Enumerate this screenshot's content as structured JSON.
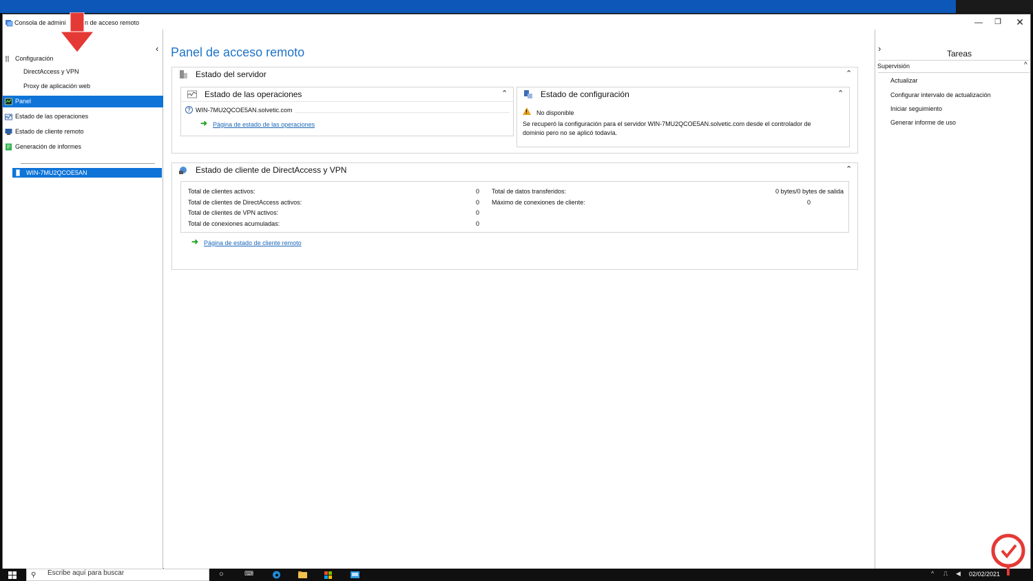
{
  "window": {
    "title": "Consola de administración de acceso remoto",
    "title_visible": "Consola de admini           n de acceso remoto"
  },
  "tree": {
    "items": [
      {
        "label": "Configuración"
      },
      {
        "label": "DirectAccess y VPN"
      },
      {
        "label": "Proxy de aplicación web"
      },
      {
        "label": "Panel"
      },
      {
        "label": "Estado de las operaciones"
      },
      {
        "label": "Estado de cliente remoto"
      },
      {
        "label": "Generación de informes"
      }
    ],
    "server": "WIN-7MU2QCOE5AN"
  },
  "main": {
    "title": "Panel de acceso remoto",
    "server_status": {
      "title": "Estado del servidor",
      "operations": {
        "title": "Estado de las operaciones",
        "server": "WIN-7MU2QCOE5AN.solvetic.com",
        "link": "Página de estado de las operaciones"
      },
      "config": {
        "title": "Estado de configuración",
        "status": "No disponible",
        "message_line1": "Se recuperó la configuración para el servidor WIN-7MU2QCOE5AN.solvetic.com desde el controlador de",
        "message_line2": "dominio pero no se aplicó todavía."
      }
    },
    "clients": {
      "title": "Estado de cliente de DirectAccess y VPN",
      "left_stats": [
        {
          "label": "Total de clientes activos:",
          "value": "0"
        },
        {
          "label": "Total de clientes de DirectAccess activos:",
          "value": "0"
        },
        {
          "label": "Total de clientes de VPN activos:",
          "value": "0"
        },
        {
          "label": "Total de conexiones acumuladas:",
          "value": "0"
        }
      ],
      "right_stats": [
        {
          "label": "Total de datos transferidos:",
          "value": "0 bytes/0 bytes de salida"
        },
        {
          "label": "Máximo de conexiones de cliente:",
          "value": "0"
        }
      ],
      "link": "Página de estado de cliente remoto"
    }
  },
  "tasks": {
    "title": "Tareas",
    "section": "Supervisión",
    "items": [
      {
        "label": "Actualizar"
      },
      {
        "label": "Configurar intervalo de actualización"
      },
      {
        "label": "Iniciar seguimiento"
      },
      {
        "label": "Generar informe de uso"
      }
    ]
  },
  "taskbar": {
    "search_placeholder": "Escribe aquí para buscar",
    "date": "02/02/2021"
  },
  "colors": {
    "accent": "#0e74d8",
    "title_blue": "#1f73c8",
    "link_blue": "#1a66b8",
    "annotation_red": "#e53935"
  },
  "icons": [
    "windows-logo-icon",
    "search-icon",
    "folder-icon",
    "edge-icon",
    "store-icon",
    "server-icon",
    "help-icon",
    "warning-icon",
    "green-arrow-icon",
    "chevron-up-icon",
    "chevron-left-icon",
    "chevron-right-icon"
  ]
}
